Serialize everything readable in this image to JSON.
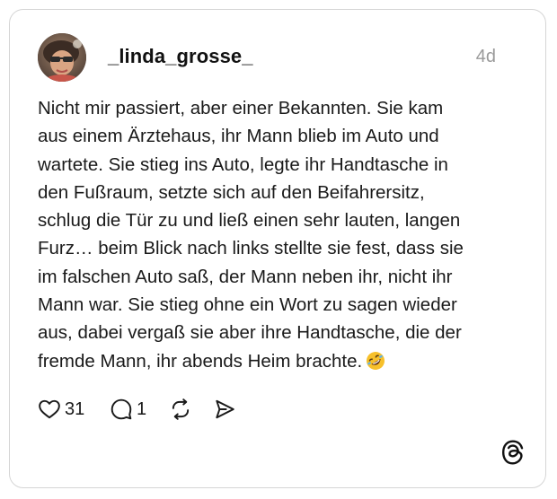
{
  "post": {
    "username": "_linda_grosse_",
    "timestamp": "4d",
    "text": "Nicht mir passiert, aber einer Bekannten. Sie kam\naus einem Ärztehaus, ihr Mann blieb im Auto und\nwartete. Sie stieg ins Auto, legte ihr Handtasche in\nden Fußraum, setzte sich auf den Beifahrersitz,\nschlug die Tür zu und ließ einen sehr lauten, langen\nFurz… beim Blick nach links stellte sie fest, dass sie\nim falschen Auto saß, der Mann neben ihr, nicht ihr\nMann war. Sie stieg ohne ein Wort zu sagen wieder\naus, dabei vergaß sie aber ihre Handtasche, die der\nfremde Mann, ihr abends Heim brachte.",
    "emoji": "rolling-on-floor-laughing-emoji",
    "actions": {
      "like_count": "31",
      "comment_count": "1",
      "icons": [
        "heart-icon",
        "comment-icon",
        "repost-icon",
        "share-icon"
      ]
    },
    "brand_icon": "threads-logo-icon"
  },
  "colors": {
    "text": "#1a1a1a",
    "timestamp": "#9a9a9a",
    "border": "#d5d5d5",
    "emoji": "#f7c02a"
  }
}
